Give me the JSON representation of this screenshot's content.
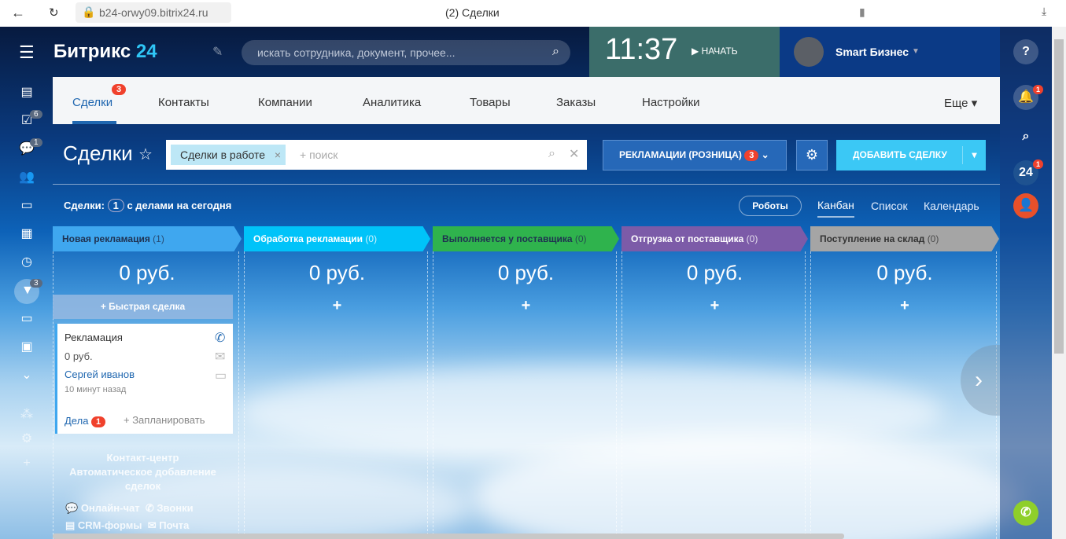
{
  "browser": {
    "url": "b24-orwy09.bitrix24.ru",
    "title": "(2) Сделки"
  },
  "header": {
    "logo_text": "Битрикс",
    "logo_num": "24",
    "search_placeholder": "искать сотрудника, документ, прочее...",
    "time": "11:37",
    "start_label": "НАЧАТЬ",
    "user": "Smart Бизнес"
  },
  "sidebar": {
    "badges": {
      "tasks": "6",
      "chat": "1",
      "crm": "3"
    }
  },
  "tabs": [
    {
      "label": "Сделки",
      "badge": "3"
    },
    {
      "label": "Контакты"
    },
    {
      "label": "Компании"
    },
    {
      "label": "Аналитика"
    },
    {
      "label": "Товары"
    },
    {
      "label": "Заказы"
    },
    {
      "label": "Настройки"
    }
  ],
  "tabs_more": "Еще",
  "page": {
    "title": "Сделки",
    "filter_chip": "Сделки в работе",
    "filter_placeholder": "+ поиск",
    "pipeline": "РЕКЛАМАЦИИ (РОЗНИЦА)",
    "pipeline_badge": "3",
    "add_button": "ДОБАВИТЬ СДЕЛКУ",
    "counter_prefix": "Сделки:",
    "counter_value": "1",
    "counter_suffix": "с делами на сегодня",
    "robots": "Роботы",
    "views": [
      "Канбан",
      "Список",
      "Календарь"
    ]
  },
  "columns": [
    {
      "name": "Новая рекламация",
      "count": "(1)",
      "sum": "0 руб.",
      "color": "#3fa7ef",
      "text": "#1f3150"
    },
    {
      "name": "Обработка рекламации",
      "count": "(0)",
      "sum": "0 руб.",
      "color": "#00c3f9",
      "text": "#ffffff"
    },
    {
      "name": "Выполняется у поставщика",
      "count": "(0)",
      "sum": "0 руб.",
      "color": "#2fb34d",
      "text": "#1f3150"
    },
    {
      "name": "Отгрузка от поставщика",
      "count": "(0)",
      "sum": "0 руб.",
      "color": "#7c5ba8",
      "text": "#ffffff"
    },
    {
      "name": "Поступление на склад",
      "count": "(0)",
      "sum": "0 руб.",
      "color": "#a5a5a5",
      "text": "#333333"
    }
  ],
  "quick_deal": "Быстрая сделка",
  "card": {
    "title": "Рекламация",
    "sum": "0 руб.",
    "contact": "Сергей иванов",
    "time": "10 минут назад",
    "activities": "Дела",
    "activities_badge": "1",
    "plan": "+ Запланировать"
  },
  "contact_center": {
    "title": "Контакт-центр",
    "subtitle": "Автоматическое добавление сделок",
    "items": [
      "Онлайн-чат",
      "Звонки",
      "CRM-формы",
      "Почта"
    ]
  },
  "rightbar": {
    "notif_badge": "1",
    "b24_badge": "1",
    "b24": "24"
  }
}
